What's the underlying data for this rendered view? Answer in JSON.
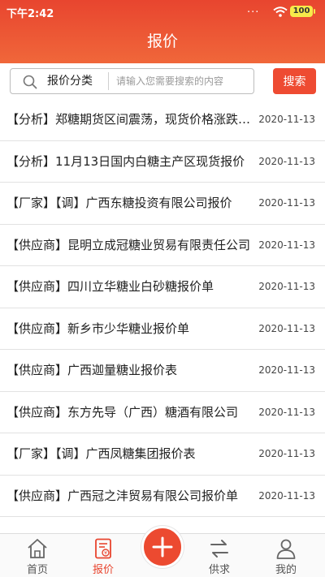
{
  "status_bar": {
    "time": "下午2:42",
    "dots": "...",
    "battery": "100"
  },
  "page": {
    "title": "报价"
  },
  "search": {
    "category_label": "报价分类",
    "placeholder": "请输入您需要搜索的内容",
    "value": "",
    "button_label": "搜索"
  },
  "items": [
    {
      "title": "【分析】郑糖期货区间震荡，现货价格涨跌互现",
      "date": "2020-11-13"
    },
    {
      "title": "【分析】11月13日国内白糖主产区现货报价",
      "date": "2020-11-13"
    },
    {
      "title": "【厂家】【调】广西东糖投资有限公司报价",
      "date": "2020-11-13"
    },
    {
      "title": "【供应商】昆明立成冠糖业贸易有限责任公司",
      "date": "2020-11-13"
    },
    {
      "title": "【供应商】四川立华糖业白砂糖报价单",
      "date": "2020-11-13"
    },
    {
      "title": "【供应商】新乡市少华糖业报价单",
      "date": "2020-11-13"
    },
    {
      "title": "【供应商】广西迦量糖业报价表",
      "date": "2020-11-13"
    },
    {
      "title": "【供应商】东方先导（广西）糖酒有限公司",
      "date": "2020-11-13"
    },
    {
      "title": "【厂家】【调】广西凤糖集团报价表",
      "date": "2020-11-13"
    },
    {
      "title": "【供应商】广西冠之沣贸易有限公司报价单",
      "date": "2020-11-13"
    }
  ],
  "tabbar": {
    "home": "首页",
    "quote": "报价",
    "supply": "供求",
    "mine": "我的"
  },
  "colors": {
    "accent": "#e8452f",
    "accent_light": "#f0673a"
  },
  "icons": {
    "search": "search-icon",
    "home": "home-icon",
    "quote": "document-icon",
    "add": "plus-icon",
    "supply": "swap-arrows-icon",
    "mine": "user-icon"
  }
}
